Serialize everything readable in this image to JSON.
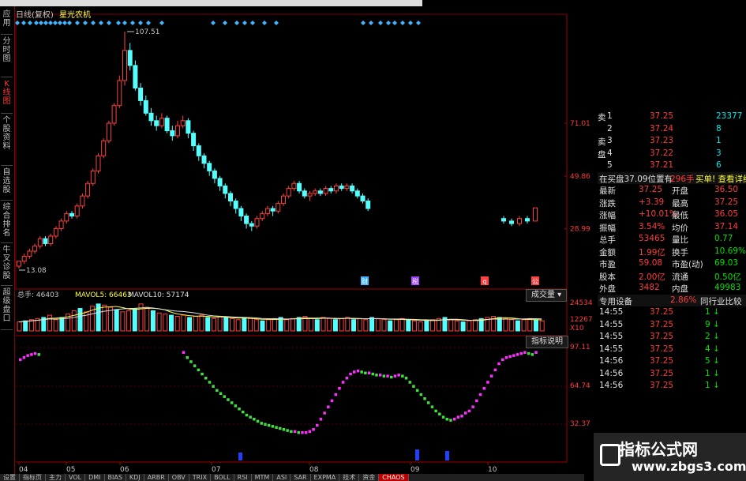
{
  "title_bar": {
    "period": "日线(复权)",
    "name": "星光农机"
  },
  "left_tabs": [
    {
      "label": "应用",
      "active": false
    },
    {
      "label": "分时图",
      "active": false
    },
    {
      "label": "K线图",
      "active": true
    },
    {
      "label": "个股资料",
      "active": false
    },
    {
      "label": "自选股",
      "active": false
    },
    {
      "label": "综合排名",
      "active": false
    },
    {
      "label": "牛叉诊股",
      "active": false
    },
    {
      "label": "超级盘口",
      "active": false
    }
  ],
  "price_axis": {
    "labels": [
      "71.01",
      "49.86",
      "28.99"
    ],
    "high_mark": "107.51",
    "low_mark": "13.08"
  },
  "event_markers": [
    "财",
    "税",
    "q",
    "公"
  ],
  "volume": {
    "total_label": "总手:",
    "total": "46403",
    "ma5_label": "MAVOL5:",
    "ma5": "66463",
    "ma10_label": "MAVOL10:",
    "ma10": "57174",
    "axis": [
      "24534",
      "12267",
      "X10"
    ],
    "button": "成交量"
  },
  "indicator": {
    "button": "指标说明",
    "axis": [
      "97.11",
      "64.74",
      "32.37"
    ]
  },
  "x_axis": [
    "04",
    "05",
    "06",
    "07",
    "08",
    "09",
    "10"
  ],
  "order_book": [
    {
      "side": "卖",
      "level": "1",
      "price": "37.25",
      "vol": "23377"
    },
    {
      "side": "",
      "level": "2",
      "price": "37.24",
      "vol": "8"
    },
    {
      "side": "卖",
      "level": "3",
      "price": "37.23",
      "vol": "1"
    },
    {
      "side": "盘",
      "level": "4",
      "price": "37.22",
      "vol": "3"
    },
    {
      "side": "",
      "level": "5",
      "price": "37.21",
      "vol": "6"
    }
  ],
  "buy_info": {
    "text": "在买盘37.09位置有",
    "qty": "296手",
    "action": "买单! 查看详细"
  },
  "quote": [
    {
      "l1": "最新",
      "v1": "37.25",
      "l2": "开盘",
      "v2": "36.50"
    },
    {
      "l1": "涨跌",
      "v1": "+3.39",
      "l2": "最高",
      "v2": "37.25"
    },
    {
      "l1": "涨幅",
      "v1": "+10.01%",
      "l2": "最低",
      "v2": "36.05"
    },
    {
      "l1": "振幅",
      "v1": "3.54%",
      "l2": "均价",
      "v2": "37.14"
    },
    {
      "l1": "总手",
      "v1": "53465",
      "l2": "量比",
      "v2": "0.77"
    },
    {
      "l1": "金额",
      "v1": "1.99亿",
      "l2": "换手",
      "v2": "10.69%"
    },
    {
      "l1": "市盈",
      "v1": "59.08",
      "l2": "市盈(动)",
      "v2": "69.03"
    },
    {
      "l1": "股本",
      "v1": "2.00亿",
      "l2": "流通",
      "v2": "0.50亿"
    },
    {
      "l1": "外盘",
      "v1": "3482",
      "l2": "内盘",
      "v2": "49983"
    }
  ],
  "sector": {
    "name": "专用设备",
    "pct": "2.86%",
    "link": "同行业比较"
  },
  "ticks": [
    {
      "time": "14:55",
      "price": "37.25",
      "vol": "1"
    },
    {
      "time": "14:55",
      "price": "37.25",
      "vol": "9"
    },
    {
      "time": "14:55",
      "price": "37.25",
      "vol": "2"
    },
    {
      "time": "14:55",
      "price": "37.25",
      "vol": "4"
    },
    {
      "time": "14:56",
      "price": "37.25",
      "vol": "5"
    },
    {
      "time": "14:56",
      "price": "37.25",
      "vol": "1"
    },
    {
      "time": "14:56",
      "price": "37.25",
      "vol": "1"
    }
  ],
  "bottom_tabs": [
    "设置",
    "指标页",
    "主力",
    "VOL",
    "DMI",
    "BIAS",
    "KDJ",
    "ARBR",
    "OBV",
    "TRIX",
    "BOLL",
    "RSI",
    "MTM",
    "ASI",
    "SAR",
    "EXPMA",
    "技术",
    "资金",
    "CHAOS"
  ],
  "watermark": {
    "line1": "指标公式网",
    "line2": "www.zbgs3.com"
  },
  "chart_data": {
    "type": "candlestick",
    "price_range": [
      13.08,
      107.51
    ],
    "price_labels": [
      71.01,
      49.86,
      28.99
    ],
    "candles": [
      [
        14,
        16,
        13.08,
        16
      ],
      [
        16,
        18,
        15,
        19
      ],
      [
        18,
        20,
        17,
        21
      ],
      [
        20,
        22,
        19,
        23
      ],
      [
        22,
        25,
        21,
        26
      ],
      [
        25,
        23,
        22,
        26
      ],
      [
        23,
        26,
        22,
        27
      ],
      [
        26,
        29,
        25,
        30
      ],
      [
        29,
        32,
        28,
        33
      ],
      [
        32,
        35,
        31,
        36
      ],
      [
        35,
        34,
        33,
        36
      ],
      [
        34,
        38,
        33,
        39
      ],
      [
        38,
        42,
        37,
        43
      ],
      [
        42,
        47,
        41,
        48
      ],
      [
        47,
        52,
        46,
        53
      ],
      [
        52,
        58,
        51,
        59
      ],
      [
        58,
        64,
        57,
        65
      ],
      [
        64,
        71,
        63,
        72
      ],
      [
        71,
        78,
        70,
        79
      ],
      [
        78,
        88,
        77,
        90
      ],
      [
        88,
        100,
        86,
        107.51
      ],
      [
        100,
        94,
        92,
        103
      ],
      [
        94,
        85,
        84,
        96
      ],
      [
        85,
        80,
        78,
        87
      ],
      [
        80,
        75,
        74,
        82
      ],
      [
        75,
        72,
        70,
        77
      ],
      [
        72,
        70,
        68,
        74
      ],
      [
        70,
        73,
        69,
        75
      ],
      [
        73,
        68,
        67,
        74
      ],
      [
        68,
        66,
        64,
        70
      ],
      [
        66,
        70,
        65,
        72
      ],
      [
        70,
        72,
        69,
        74
      ],
      [
        72,
        67,
        65,
        73
      ],
      [
        67,
        62,
        60,
        68
      ],
      [
        62,
        58,
        56,
        63
      ],
      [
        58,
        55,
        53,
        59
      ],
      [
        55,
        52,
        50,
        56
      ],
      [
        52,
        49,
        47,
        53
      ],
      [
        49,
        46,
        44,
        50
      ],
      [
        46,
        43,
        41,
        47
      ],
      [
        43,
        40,
        38,
        44
      ],
      [
        40,
        37,
        35,
        41
      ],
      [
        37,
        34,
        32,
        38
      ],
      [
        34,
        31,
        29,
        35
      ],
      [
        31,
        30,
        28,
        32
      ],
      [
        30,
        33,
        29,
        34
      ],
      [
        33,
        35,
        32,
        36
      ],
      [
        35,
        37,
        34,
        38
      ],
      [
        37,
        36,
        34,
        38
      ],
      [
        36,
        39,
        35,
        40
      ],
      [
        39,
        42,
        38,
        43
      ],
      [
        42,
        45,
        41,
        46
      ],
      [
        45,
        47,
        44,
        48
      ],
      [
        47,
        44,
        43,
        48
      ],
      [
        44,
        42,
        41,
        45
      ],
      [
        42,
        43,
        40,
        44
      ],
      [
        43,
        44,
        42,
        45
      ],
      [
        44,
        43,
        42,
        45
      ],
      [
        43,
        45,
        42,
        46
      ],
      [
        45,
        44,
        43,
        46
      ],
      [
        44,
        46,
        43,
        47
      ],
      [
        46,
        45,
        44,
        47
      ],
      [
        45,
        46,
        44,
        47
      ],
      [
        46,
        44,
        43,
        47
      ],
      [
        44,
        42,
        41,
        45
      ],
      [
        42,
        40,
        39,
        43
      ],
      [
        40,
        37,
        36,
        41
      ]
    ],
    "gap_candles": [
      [
        33,
        32,
        31,
        34
      ],
      [
        32,
        31,
        30,
        33
      ],
      [
        31,
        33,
        30,
        34
      ],
      [
        33,
        32,
        31,
        34
      ],
      [
        32,
        37.25,
        32,
        37.25
      ]
    ],
    "volume": [
      8,
      9,
      10,
      11,
      12,
      14,
      10,
      12,
      15,
      18,
      20,
      17,
      22,
      24,
      23,
      21,
      19,
      17,
      18,
      20,
      24,
      21,
      18,
      16,
      15,
      14,
      13,
      14,
      12,
      13,
      14,
      12,
      11,
      13,
      12,
      11,
      10,
      12,
      11,
      10,
      9,
      10,
      11,
      12,
      10,
      11,
      12,
      13,
      11,
      10,
      12,
      11,
      10,
      11,
      12,
      10,
      11,
      10,
      12,
      11,
      10,
      9,
      10,
      11,
      10,
      9,
      8,
      9,
      10,
      11,
      12,
      10,
      9,
      8,
      9,
      10,
      11,
      12,
      13,
      12,
      11,
      10,
      9,
      10,
      11,
      10,
      9
    ],
    "mavol5_pct": 0.62,
    "indicator": [
      88,
      90,
      92,
      93,
      94,
      93,
      null,
      null,
      null,
      null,
      null,
      null,
      null,
      null,
      null,
      null,
      null,
      null,
      null,
      null,
      null,
      null,
      null,
      null,
      null,
      null,
      null,
      null,
      null,
      null,
      null,
      null,
      null,
      null,
      null,
      null,
      null,
      null,
      null,
      null,
      null,
      null,
      null,
      null,
      95,
      90,
      86,
      82,
      78,
      74,
      70,
      66,
      62,
      58,
      55,
      52,
      49,
      46,
      43,
      40,
      37,
      34,
      32,
      30,
      28,
      26,
      25,
      24,
      23,
      22,
      21,
      20,
      19,
      18,
      18,
      17,
      17,
      17,
      18,
      20,
      24,
      30,
      36,
      42,
      48,
      54,
      60,
      66,
      70,
      74,
      76,
      77,
      76,
      75,
      75,
      74,
      73,
      73,
      72,
      72,
      71,
      72,
      73,
      72,
      70,
      66,
      62,
      58,
      54,
      50,
      46,
      42,
      38,
      35,
      32,
      30,
      29,
      30,
      32,
      33,
      36,
      38,
      42,
      48,
      54,
      60,
      66,
      72,
      78,
      84,
      88,
      90,
      91,
      92,
      93,
      94,
      95,
      94,
      93,
      95
    ],
    "indicator_colors_rule": "rising=magenta, falling=green"
  }
}
